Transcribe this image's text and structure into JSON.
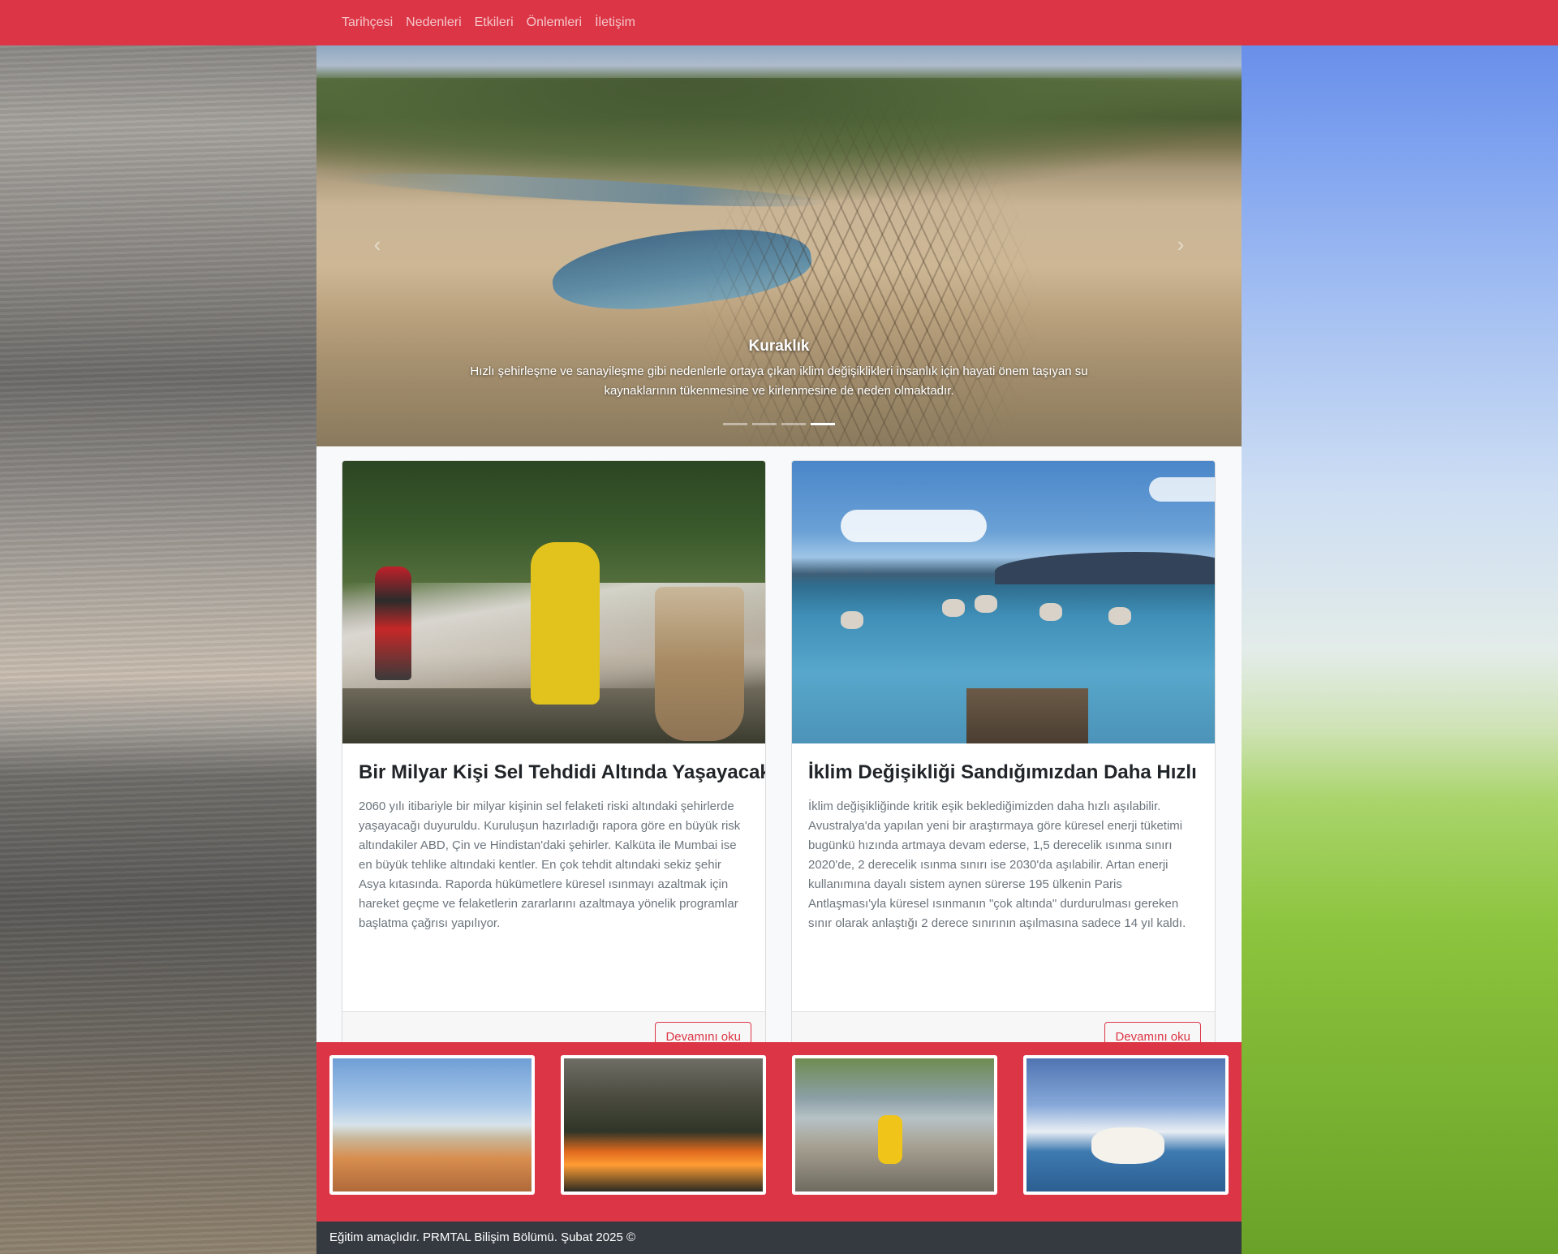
{
  "nav": {
    "items": [
      {
        "label": "Tarihçesi"
      },
      {
        "label": "Nedenleri"
      },
      {
        "label": "Etkileri"
      },
      {
        "label": "Önlemleri"
      },
      {
        "label": "İletişim"
      }
    ]
  },
  "carousel": {
    "title": "Kuraklık",
    "text": "Hızlı şehirleşme ve sanayileşme gibi nedenlerle ortaya çıkan iklim değişiklikleri insanlık için hayati önem taşıyan su kaynaklarının tükenmesine ve kirlenmesine de neden olmaktadır.",
    "prev_icon": "chevron-left-icon",
    "next_icon": "chevron-right-icon",
    "prev_glyph": "‹",
    "next_glyph": "›",
    "slide_count": 4,
    "active_slide": 4
  },
  "cards": [
    {
      "title": "Bir Milyar Kişi Sel Tehdidi Altında Yaşayacak",
      "text": "2060 yılı itibariyle bir milyar kişinin sel felaketi riski altındaki şehirlerde yaşayacağı duyuruldu. Kuruluşun hazırladığı rapora göre en büyük risk altındakiler ABD, Çin ve Hindistan'daki şehirler. Kalküta ile Mumbai ise en büyük tehlike altındaki kentler. En çok tehdit altındaki sekiz şehir Asya kıtasında. Raporda hükümetlere küresel ısınmayı azaltmak için hareket geçme ve felaketlerin zararlarını azaltmaya yönelik programlar başlatma çağrısı yapılıyor.",
      "button": "Devamını oku"
    },
    {
      "title": "İklim Değişikliği Sandığımızdan Daha Hızlı",
      "text": "İklim değişikliğinde kritik eşik beklediğimizden daha hızlı aşılabilir. Avustralya'da yapılan yeni bir araştırmaya göre küresel enerji tüketimi bugünkü hızında artmaya devam ederse, 1,5 derecelik ısınma sınırı 2020'de, 2 derecelik ısınma sınırı ise 2030'da aşılabilir. Artan enerji kullanımına dayalı sistem aynen sürerse 195 ülkenin Paris Antlaşması'yla küresel ısınmanın \"çok altında\" durdurulması gereken sınır olarak anlaştığı 2 derece sınırının aşılmasına sadece 14 yıl kaldı.",
      "button": "Devamını oku"
    }
  ],
  "footer": {
    "text": "Eğitim amaçlıdır. PRMTAL Bilişim Bölümü. Şubat 2025 ©"
  },
  "colors": {
    "primary": "#dc3545",
    "footer_bg": "#343a40"
  }
}
